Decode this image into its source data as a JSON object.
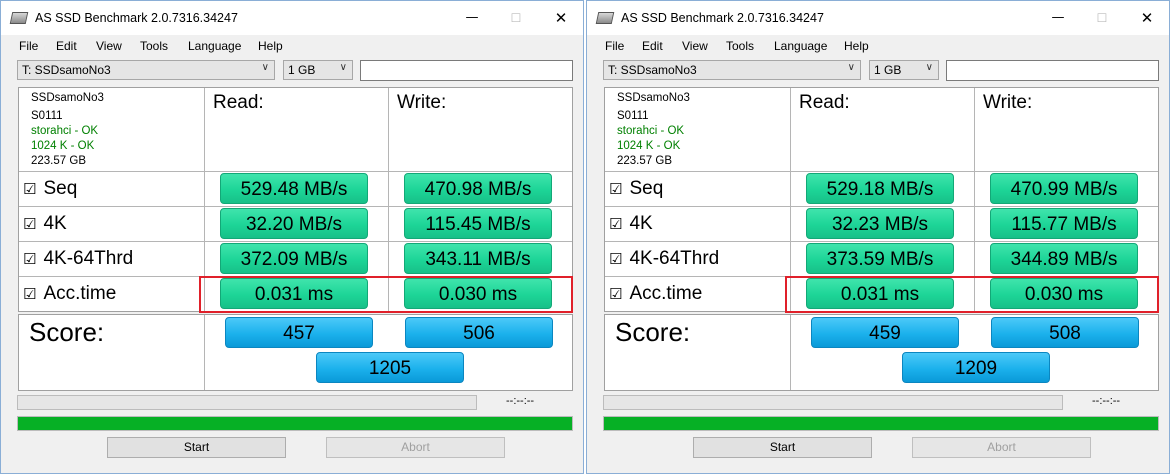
{
  "windows": [
    {
      "title": "AS SSD Benchmark 2.0.7316.34247",
      "menu": [
        "File",
        "Edit",
        "View",
        "Tools",
        "Language",
        "Help"
      ],
      "drive": "T: SSDsamoNo3",
      "size": "1 GB",
      "info": {
        "name": "SSDsamoNo3",
        "firmware": "S0111",
        "driver": "storahci - OK",
        "alignment": "1024 K - OK",
        "capacity": "223.57 GB"
      },
      "headers": {
        "read": "Read:",
        "write": "Write:"
      },
      "rows": [
        {
          "label": "Seq",
          "read": "529.48 MB/s",
          "write": "470.98 MB/s"
        },
        {
          "label": "4K",
          "read": "32.20 MB/s",
          "write": "115.45 MB/s"
        },
        {
          "label": "4K-64Thrd",
          "read": "372.09 MB/s",
          "write": "343.11 MB/s"
        },
        {
          "label": "Acc.time",
          "read": "0.031 ms",
          "write": "0.030 ms"
        }
      ],
      "score": {
        "label": "Score:",
        "read": "457",
        "write": "506",
        "total": "1205"
      },
      "time": "--:--:--",
      "progress": 1.0,
      "buttons": {
        "start": "Start",
        "abort": "Abort"
      }
    },
    {
      "title": "AS SSD Benchmark 2.0.7316.34247",
      "menu": [
        "File",
        "Edit",
        "View",
        "Tools",
        "Language",
        "Help"
      ],
      "drive": "T: SSDsamoNo3",
      "size": "1 GB",
      "info": {
        "name": "SSDsamoNo3",
        "firmware": "S0111",
        "driver": "storahci - OK",
        "alignment": "1024 K - OK",
        "capacity": "223.57 GB"
      },
      "headers": {
        "read": "Read:",
        "write": "Write:"
      },
      "rows": [
        {
          "label": "Seq",
          "read": "529.18 MB/s",
          "write": "470.99 MB/s"
        },
        {
          "label": "4K",
          "read": "32.23 MB/s",
          "write": "115.77 MB/s"
        },
        {
          "label": "4K-64Thrd",
          "read": "373.59 MB/s",
          "write": "344.89 MB/s"
        },
        {
          "label": "Acc.time",
          "read": "0.031 ms",
          "write": "0.030 ms"
        }
      ],
      "score": {
        "label": "Score:",
        "read": "459",
        "write": "508",
        "total": "1209"
      },
      "time": "--:--:--",
      "progress": 1.0,
      "buttons": {
        "start": "Start",
        "abort": "Abort"
      }
    }
  ],
  "highlight_color": "#e0202a",
  "value_color": "#1dd597",
  "score_color": "#1bb1ec",
  "progress_color": "#06b025"
}
